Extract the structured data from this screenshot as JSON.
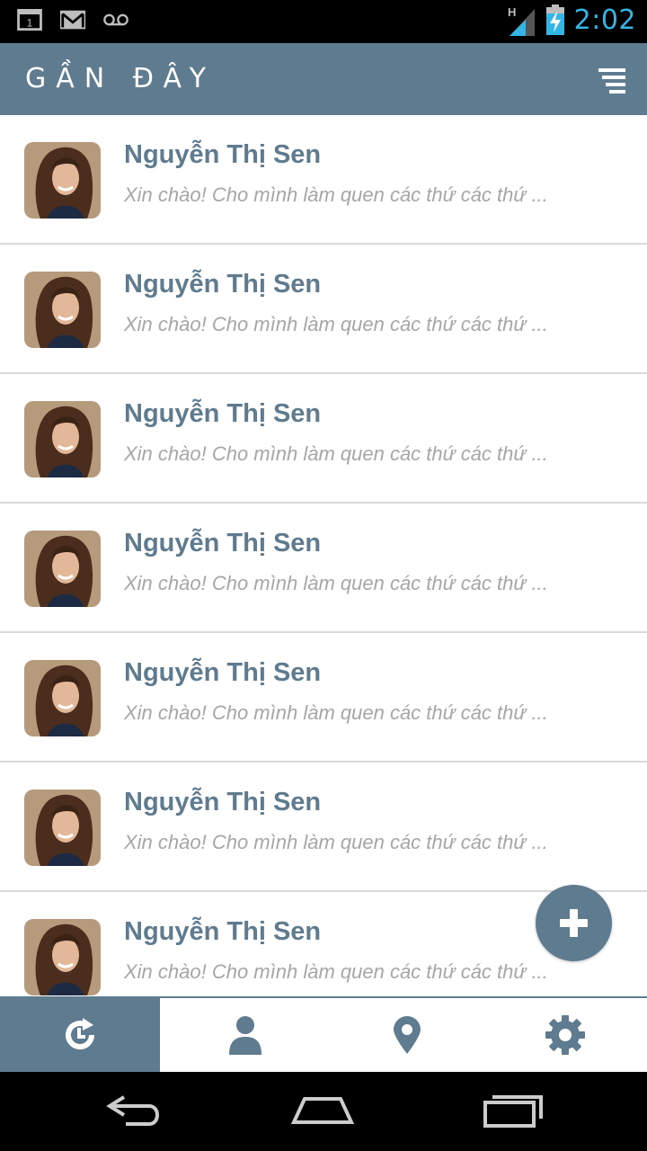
{
  "status_bar": {
    "time": "2:02",
    "network_label": "H",
    "icons": [
      "calendar-icon",
      "gmail-icon",
      "voicemail-icon",
      "signal-icon",
      "battery-charging-icon"
    ],
    "calendar_day": "1"
  },
  "header": {
    "title": "GẦN ĐÂY",
    "menu_icon": "filter-menu-icon"
  },
  "conversations": [
    {
      "name": "Nguyễn Thị Sen",
      "preview": "Xin chào! Cho mình làm quen các thứ các thứ ..."
    },
    {
      "name": "Nguyễn Thị Sen",
      "preview": "Xin chào! Cho mình làm quen các thứ các thứ ..."
    },
    {
      "name": "Nguyễn Thị Sen",
      "preview": "Xin chào! Cho mình làm quen các thứ các thứ ..."
    },
    {
      "name": "Nguyễn Thị Sen",
      "preview": "Xin chào! Cho mình làm quen các thứ các thứ ..."
    },
    {
      "name": "Nguyễn Thị Sen",
      "preview": "Xin chào! Cho mình làm quen các thứ các thứ ..."
    },
    {
      "name": "Nguyễn Thị Sen",
      "preview": "Xin chào! Cho mình làm quen các thứ các thứ ..."
    },
    {
      "name": "Nguyễn Thị Sen",
      "preview": "Xin chào! Cho mình làm quen các thứ các thứ ..."
    }
  ],
  "fab": {
    "icon": "plus-icon"
  },
  "tabs": [
    {
      "icon": "recent-icon",
      "active": true
    },
    {
      "icon": "person-icon",
      "active": false
    },
    {
      "icon": "location-pin-icon",
      "active": false
    },
    {
      "icon": "gear-icon",
      "active": false
    }
  ],
  "nav_bar": {
    "icons": [
      "back-icon",
      "home-icon",
      "recent-apps-icon"
    ]
  },
  "colors": {
    "accent": "#5f7b8f",
    "time": "#33b5e5",
    "preview_text": "#a6a6a6",
    "divider": "#d9d9d9"
  }
}
